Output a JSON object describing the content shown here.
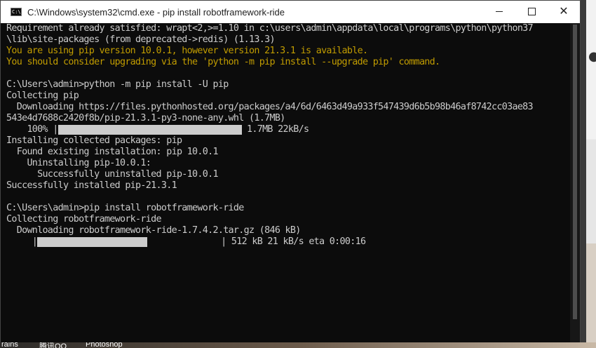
{
  "window": {
    "title": "C:\\Windows\\system32\\cmd.exe - pip  install robotframework-ride",
    "icon_glyph": "C:\\",
    "minimize_icon": "minimize-icon",
    "maximize_icon": "maximize-icon",
    "close_glyph": "✕"
  },
  "console": {
    "lines": [
      {
        "text": "Requirement already satisfied: wrapt<2,>=1.10 in c:\\users\\admin\\appdata\\local\\programs\\python\\python37",
        "style": "normal"
      },
      {
        "text": "\\lib\\site-packages (from deprecated->redis) (1.13.3)",
        "style": "normal"
      },
      {
        "text": "You are using pip version 10.0.1, however version 21.3.1 is available.",
        "style": "warn"
      },
      {
        "text": "You should consider upgrading via the 'python -m pip install --upgrade pip' command.",
        "style": "warn"
      },
      {
        "text": "",
        "style": "normal"
      },
      {
        "text": "C:\\Users\\admin>python -m pip install -U pip",
        "style": "normal"
      },
      {
        "text": "Collecting pip",
        "style": "normal"
      },
      {
        "text": "  Downloading https://files.pythonhosted.org/packages/a4/6d/6463d49a933f547439d6b5b98b46af8742cc03ae83",
        "style": "normal"
      },
      {
        "text": "543e4d7688c2420f8b/pip-21.3.1-py3-none-any.whl (1.7MB)",
        "style": "normal"
      }
    ],
    "progress1": {
      "prefix": "    100% |",
      "fill": 1.0,
      "suffix": " 1.7MB 22kB/s"
    },
    "lines2": [
      {
        "text": "Installing collected packages: pip",
        "style": "normal"
      },
      {
        "text": "  Found existing installation: pip 10.0.1",
        "style": "normal"
      },
      {
        "text": "    Uninstalling pip-10.0.1:",
        "style": "normal"
      },
      {
        "text": "      Successfully uninstalled pip-10.0.1",
        "style": "normal"
      },
      {
        "text": "Successfully installed pip-21.3.1",
        "style": "normal"
      },
      {
        "text": "",
        "style": "normal"
      },
      {
        "text": "C:\\Users\\admin>pip install robotframework-ride",
        "style": "normal"
      },
      {
        "text": "Collecting robotframework-ride",
        "style": "normal"
      },
      {
        "text": "  Downloading robotframework-ride-1.7.4.2.tar.gz (846 kB)",
        "style": "normal"
      }
    ],
    "progress2": {
      "prefix": "     |",
      "fill": 0.6,
      "suffix": "| 512 kB 21 kB/s eta 0:00:16"
    }
  },
  "taskbar": {
    "items": [
      "rains",
      "腾讯QQ",
      "Photoshop"
    ]
  },
  "colors": {
    "console_bg": "#0c0c0c",
    "console_text": "#cccccc",
    "warning_text": "#c19c00"
  }
}
